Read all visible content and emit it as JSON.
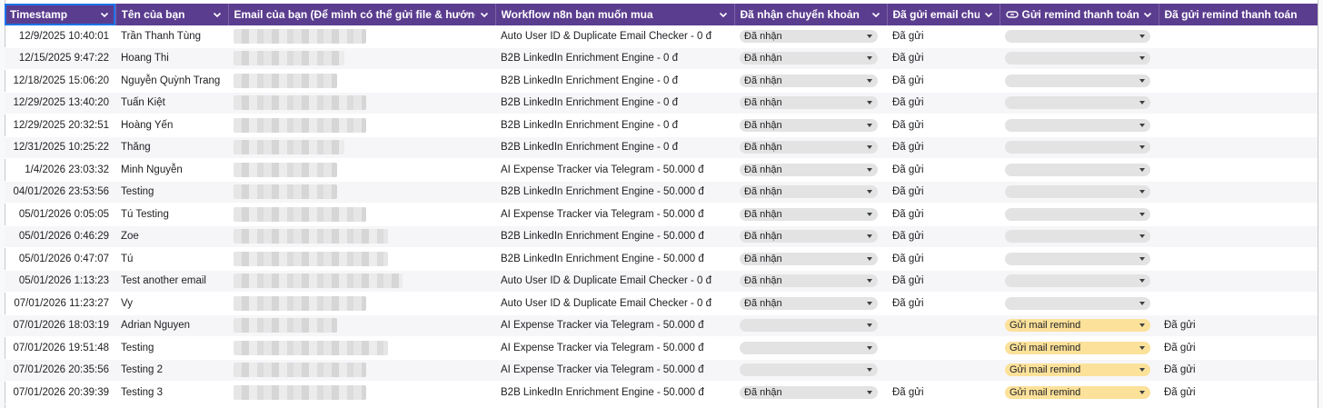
{
  "headers": [
    "Timestamp",
    "Tên của bạn",
    "Email của bạn (Để mình có thể gửi file & hướng dẫn)",
    "Workflow n8n bạn muốn mua",
    "Đã nhận chuyển khoản",
    "Đã gửi email chưa?",
    "Gửi remind thanh toán",
    "Đã gửi remind thanh toán chưa"
  ],
  "rows": [
    {
      "timestamp": "12/9/2025 10:40:01",
      "name": "Trần Thanh Tùng",
      "workflow": "Auto User ID & Duplicate Email Checker - 0 đ",
      "received": "Đã nhận",
      "email_sent": "Đã gửi",
      "remind": "",
      "remind_sent": ""
    },
    {
      "timestamp": "12/15/2025 9:47:22",
      "name": "Hoang Thi",
      "workflow": "B2B LinkedIn Enrichment Engine - 0 đ",
      "received": "Đã nhận",
      "email_sent": "Đã gửi",
      "remind": "",
      "remind_sent": ""
    },
    {
      "timestamp": "12/18/2025 15:06:20",
      "name": "Nguyễn Quỳnh Trang",
      "workflow": "B2B LinkedIn Enrichment Engine - 0 đ",
      "received": "Đã nhận",
      "email_sent": "Đã gửi",
      "remind": "",
      "remind_sent": ""
    },
    {
      "timestamp": "12/29/2025 13:40:20",
      "name": "Tuấn Kiệt",
      "workflow": "B2B LinkedIn Enrichment Engine - 0 đ",
      "received": "Đã nhận",
      "email_sent": "Đã gửi",
      "remind": "",
      "remind_sent": ""
    },
    {
      "timestamp": "12/29/2025 20:32:51",
      "name": "Hoàng Yến",
      "workflow": "B2B LinkedIn Enrichment Engine - 0 đ",
      "received": "Đã nhận",
      "email_sent": "Đã gửi",
      "remind": "",
      "remind_sent": ""
    },
    {
      "timestamp": "12/31/2025 10:25:22",
      "name": "Thăng",
      "workflow": "B2B LinkedIn Enrichment Engine - 0 đ",
      "received": "Đã nhận",
      "email_sent": "Đã gửi",
      "remind": "",
      "remind_sent": ""
    },
    {
      "timestamp": "1/4/2026 23:03:32",
      "name": "Minh Nguyễn",
      "workflow": "AI Expense Tracker via Telegram - 50.000 đ",
      "received": "Đã nhận",
      "email_sent": "Đã gửi",
      "remind": "",
      "remind_sent": ""
    },
    {
      "timestamp": "04/01/2026 23:53:56",
      "name": "Testing",
      "workflow": "B2B LinkedIn Enrichment Engine - 50.000 đ",
      "received": "Đã nhận",
      "email_sent": "Đã gửi",
      "remind": "",
      "remind_sent": ""
    },
    {
      "timestamp": "05/01/2026 0:05:05",
      "name": "Tú Testing",
      "workflow": "AI Expense Tracker via Telegram - 50.000 đ",
      "received": "Đã nhận",
      "email_sent": "Đã gửi",
      "remind": "",
      "remind_sent": ""
    },
    {
      "timestamp": "05/01/2026 0:46:29",
      "name": "Zoe",
      "workflow": "B2B LinkedIn Enrichment Engine - 50.000 đ",
      "received": "Đã nhận",
      "email_sent": "Đã gửi",
      "remind": "",
      "remind_sent": ""
    },
    {
      "timestamp": "05/01/2026 0:47:07",
      "name": "Tú",
      "workflow": "B2B LinkedIn Enrichment Engine - 50.000 đ",
      "received": "Đã nhận",
      "email_sent": "Đã gửi",
      "remind": "",
      "remind_sent": ""
    },
    {
      "timestamp": "05/01/2026 1:13:23",
      "name": "Test another email",
      "workflow": "Auto User ID & Duplicate Email Checker - 0 đ",
      "received": "Đã nhận",
      "email_sent": "Đã gửi",
      "remind": "",
      "remind_sent": ""
    },
    {
      "timestamp": "07/01/2026 11:23:27",
      "name": "Vy",
      "workflow": "Auto User ID & Duplicate Email Checker - 0 đ",
      "received": "Đã nhận",
      "email_sent": "Đã gửi",
      "remind": "",
      "remind_sent": ""
    },
    {
      "timestamp": "07/01/2026 18:03:19",
      "name": "Adrian Nguyen",
      "workflow": "AI Expense Tracker via Telegram - 50.000 đ",
      "received": "",
      "email_sent": "",
      "remind": "Gửi mail remind",
      "remind_sent": "Đã gửi"
    },
    {
      "timestamp": "07/01/2026 19:51:48",
      "name": "Testing",
      "workflow": "AI Expense Tracker via Telegram - 50.000 đ",
      "received": "",
      "email_sent": "",
      "remind": "Gửi mail remind",
      "remind_sent": "Đã gửi"
    },
    {
      "timestamp": "07/01/2026 20:35:56",
      "name": "Testing 2",
      "workflow": "AI Expense Tracker via Telegram - 50.000 đ",
      "received": "",
      "email_sent": "",
      "remind": "Gửi mail remind",
      "remind_sent": "Đã gửi"
    },
    {
      "timestamp": "07/01/2026 20:39:39",
      "name": "Testing 3",
      "workflow": "B2B LinkedIn Enrichment Engine - 50.000 đ",
      "received": "Đã nhận",
      "email_sent": "Đã gửi",
      "remind": "Gửi mail remind",
      "remind_sent": "Đã gửi"
    }
  ],
  "email_blur_widths": [
    146,
    122,
    114,
    146,
    146,
    122,
    114,
    114,
    146,
    170,
    170,
    186,
    146,
    114,
    170,
    146,
    146
  ],
  "colors": {
    "header_bg": "#5b3d8f",
    "chip_grey": "#e3e3e3",
    "chip_yellow": "#fce19a",
    "selection": "#1a73e8"
  }
}
